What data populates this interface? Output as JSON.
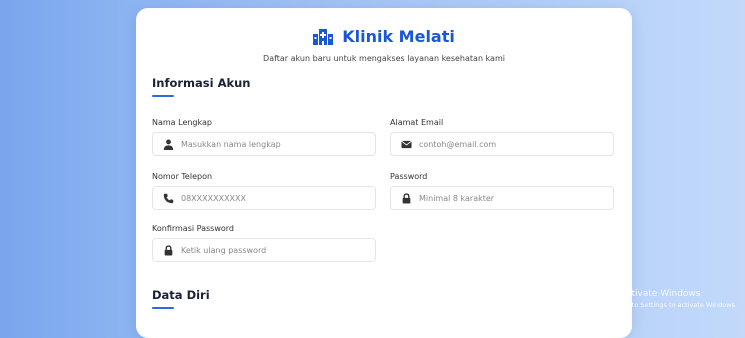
{
  "brand": {
    "name": "Klinik Melati",
    "logo_icon": "hospital-icon",
    "color": "#1a56d6"
  },
  "subtitle": "Daftar akun baru untuk mengakses layanan kesehatan kami",
  "sections": {
    "account": "Informasi Akun",
    "personal": "Data Diri"
  },
  "fields": {
    "full_name": {
      "label": "Nama Lengkap",
      "placeholder": "Masukkan nama lengkap",
      "icon": "user-icon"
    },
    "email": {
      "label": "Alamat Email",
      "placeholder": "contoh@email.com",
      "icon": "envelope-icon"
    },
    "phone": {
      "label": "Nomor Telepon",
      "placeholder": "08XXXXXXXXXX",
      "icon": "phone-icon"
    },
    "password": {
      "label": "Password",
      "placeholder": "Minimal 8 karakter",
      "icon": "lock-icon"
    },
    "confirm_password": {
      "label": "Konfirmasi Password",
      "placeholder": "Ketik ulang password",
      "icon": "lock-icon"
    }
  },
  "watermark": {
    "line1": "Activate Windows",
    "line2": "Go to Settings to activate Windows."
  },
  "colors": {
    "accent": "#2b6be0",
    "background_start": "#7aa6ee",
    "background_end": "#c2d9fa"
  }
}
